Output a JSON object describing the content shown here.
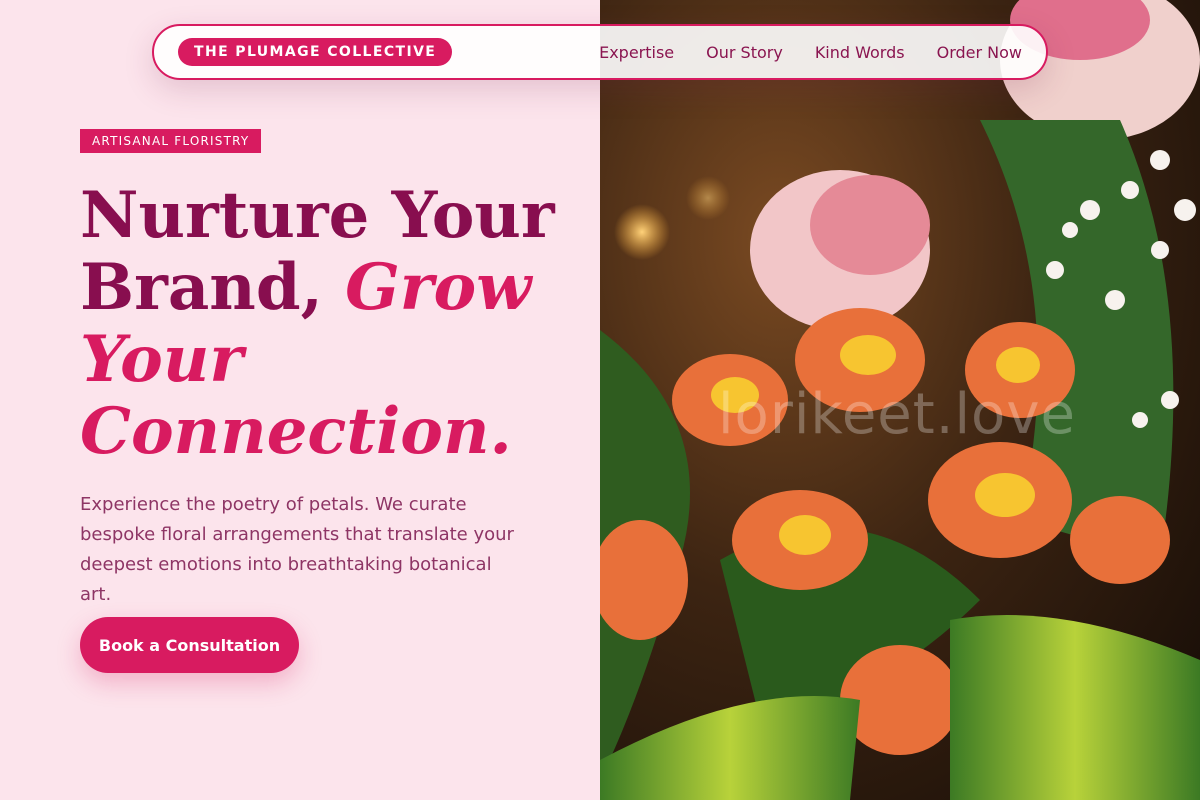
{
  "nav": {
    "brand": "THE PLUMAGE COLLECTIVE",
    "links": [
      {
        "label": "Expertise"
      },
      {
        "label": "Our Story"
      },
      {
        "label": "Kind Words"
      },
      {
        "label": "Order Now"
      }
    ]
  },
  "hero": {
    "eyebrow": "ARTISANAL FLORISTRY",
    "headline_part1": "Nurture Your Brand, ",
    "headline_part2": "Grow Your Connection.",
    "lead": "Experience the poetry of petals. We curate bespoke floral arrangements that translate your deepest emotions into breathtaking botanical art.",
    "cta_label": "Book a Consultation",
    "image_watermark": "lorikeet.love"
  },
  "colors": {
    "primary": "#d81b60",
    "headline": "#880e4f",
    "background": "#fce4ec",
    "body_text": "#8e3565"
  }
}
